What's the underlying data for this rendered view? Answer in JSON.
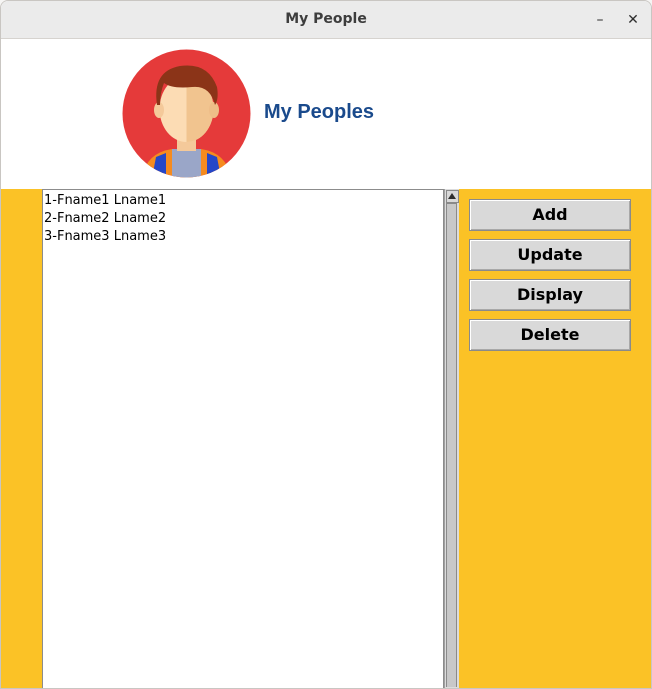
{
  "window": {
    "title": "My People",
    "minimize_icon": "minimize-icon",
    "close_icon": "close-icon",
    "minimize_label": "–",
    "close_label": "✕"
  },
  "header": {
    "title": "My Peoples",
    "avatar_icon": "person-avatar-icon"
  },
  "people_list": {
    "items": [
      "1-Fname1 Lname1",
      "2-Fname2 Lname2",
      "3-Fname3 Lname3"
    ]
  },
  "actions": {
    "add_label": "Add",
    "update_label": "Update",
    "display_label": "Display",
    "delete_label": "Delete"
  },
  "colors": {
    "accent_background": "#fbc226",
    "title_color": "#1a4a8c",
    "avatar_circle": "#e53a3a"
  }
}
